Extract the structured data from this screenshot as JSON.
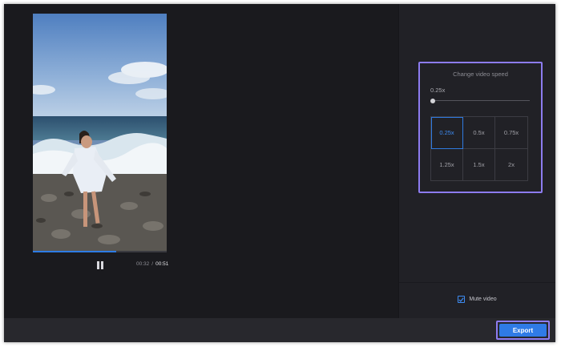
{
  "player": {
    "current_time": "00:32",
    "separator": "/",
    "total_time": "00:51",
    "progress": 0.62,
    "state": "playing",
    "pause_icon": "pause-icon"
  },
  "speed": {
    "title": "Change video speed",
    "current_value": "0.25x",
    "slider_fraction": 0.0,
    "options": [
      "0.25x",
      "0.5x",
      "0.75x",
      "1.25x",
      "1.5x",
      "2x"
    ],
    "selected_index": 0
  },
  "mute": {
    "label": "Mute video",
    "checked": true
  },
  "footer": {
    "export_label": "Export"
  },
  "colors": {
    "accent_blue": "#2f7be6",
    "highlight_purple": "#8d7cf0",
    "background": "#1a1a1e",
    "panel": "#212126"
  }
}
